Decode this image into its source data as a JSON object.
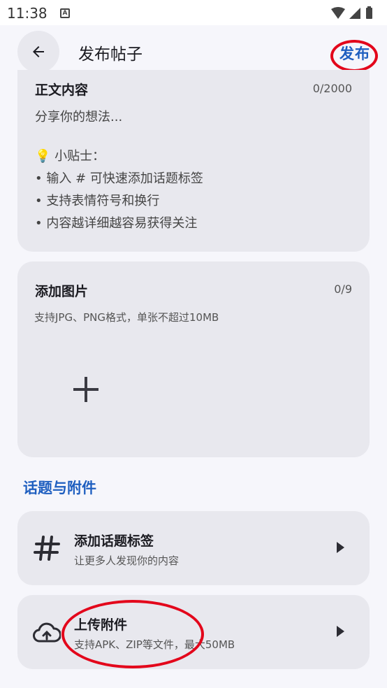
{
  "status_bar": {
    "time": "11:38",
    "notification_badge": "A"
  },
  "header": {
    "title": "发布帖子",
    "publish_label": "发布"
  },
  "content_card": {
    "heading": "正文内容",
    "count": "0/2000",
    "placeholder": "分享你的想法...",
    "tips_title": "💡 小贴士：",
    "tips": [
      "• 输入 # 可快速添加话题标签",
      "• 支持表情符号和换行",
      "• 内容越详细越容易获得关注"
    ]
  },
  "image_card": {
    "heading": "添加图片",
    "count": "0/9",
    "hint": "支持JPG、PNG格式，单张不超过10MB"
  },
  "section": {
    "label": "话题与附件"
  },
  "topic_row": {
    "title": "添加话题标签",
    "subtitle": "让更多人发现你的内容"
  },
  "attachment_row": {
    "title": "上传附件",
    "subtitle": "支持APK、ZIP等文件，最大50MB"
  },
  "colors": {
    "accent": "#1f5fc0",
    "card": "#e8e8ee",
    "annotation": "#e3061b"
  }
}
